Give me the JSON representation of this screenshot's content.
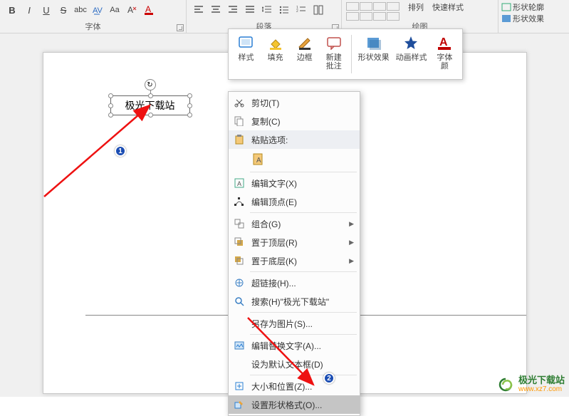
{
  "ribbon": {
    "font": {
      "label": "字体",
      "bold": "B",
      "italic": "I",
      "underline": "U",
      "strike": "S"
    },
    "paragraph": {
      "label": "段落"
    },
    "drawing": {
      "label": "绘图",
      "arrange": "排列",
      "quickstyles": "快速样式",
      "shape_outline": "形状轮廓",
      "shape_effects": "形状效果"
    }
  },
  "textbox": {
    "content": "极光下载站"
  },
  "mini_toolbar": {
    "style": "样式",
    "fill": "填充",
    "outline": "边框",
    "comment": "新建\n批注",
    "shape_effects": "形状效果",
    "anim_style": "动画样式",
    "font_color": "字体\n颜"
  },
  "context_menu": {
    "cut": "剪切(T)",
    "copy": "复制(C)",
    "paste_header": "粘贴选项:",
    "edit_text": "编辑文字(X)",
    "edit_points": "编辑顶点(E)",
    "group": "组合(G)",
    "bring_front": "置于顶层(R)",
    "send_back": "置于底层(K)",
    "hyperlink": "超链接(H)...",
    "search": "搜索(H)\"极光下载站\"",
    "save_pic": "另存为图片(S)...",
    "alt_text": "编辑替换文字(A)...",
    "set_default": "设为默认文本框(D)",
    "size_pos": "大小和位置(Z)...",
    "format_shape": "设置形状格式(O)..."
  },
  "badges": {
    "one": "1",
    "two": "2"
  },
  "watermark": {
    "name": "极光下载站",
    "url": "www.xz7.com"
  }
}
